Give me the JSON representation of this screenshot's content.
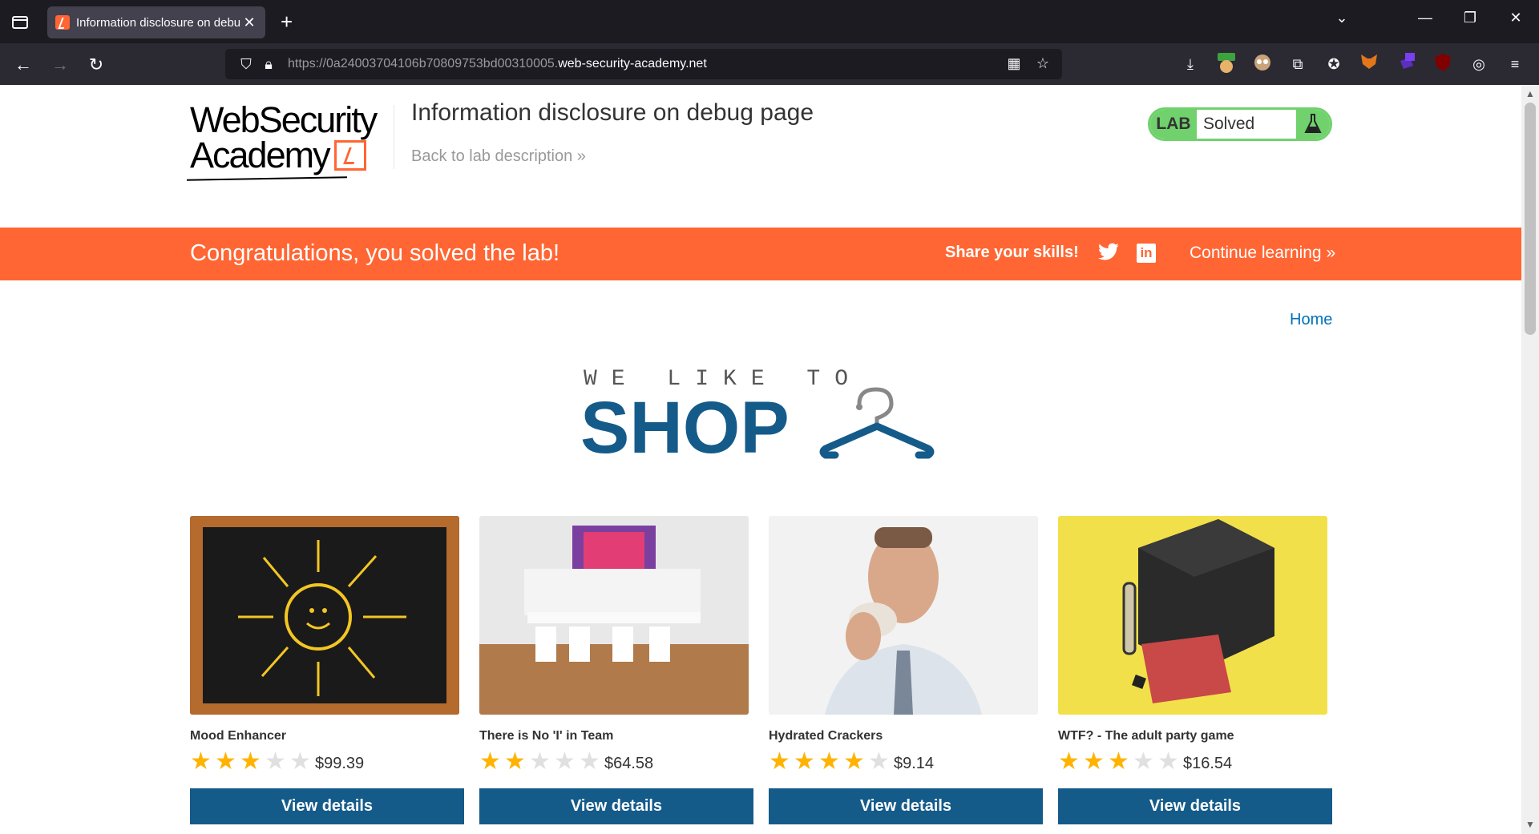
{
  "browser": {
    "tab_title": "Information disclosure on debu",
    "url_prefix": "https://0a24003704106b70809753bd00310005.",
    "url_domain": "web-security-academy.net"
  },
  "header": {
    "logo_line1": "WebSecurity",
    "logo_line2": "Academy",
    "lab_title": "Information disclosure on debug page",
    "back_link": "Back to lab description »",
    "lab_label": "LAB",
    "lab_status": "Solved"
  },
  "banner": {
    "congrats": "Congratulations, you solved the lab!",
    "share": "Share your skills!",
    "continue": "Continue learning »",
    "color": "#ff6633"
  },
  "nav": {
    "home": "Home"
  },
  "shop_logo": {
    "line1": "WE LIKE TO",
    "line2": "SHOP"
  },
  "products": [
    {
      "name": "Mood Enhancer",
      "rating": 3,
      "price": "$99.39",
      "button": "View details"
    },
    {
      "name": "There is No 'I' in Team",
      "rating": 2,
      "price": "$64.58",
      "button": "View details"
    },
    {
      "name": "Hydrated Crackers",
      "rating": 4,
      "price": "$9.14",
      "button": "View details"
    },
    {
      "name": "WTF? - The adult party game",
      "rating": 3,
      "price": "$16.54",
      "button": "View details"
    }
  ]
}
